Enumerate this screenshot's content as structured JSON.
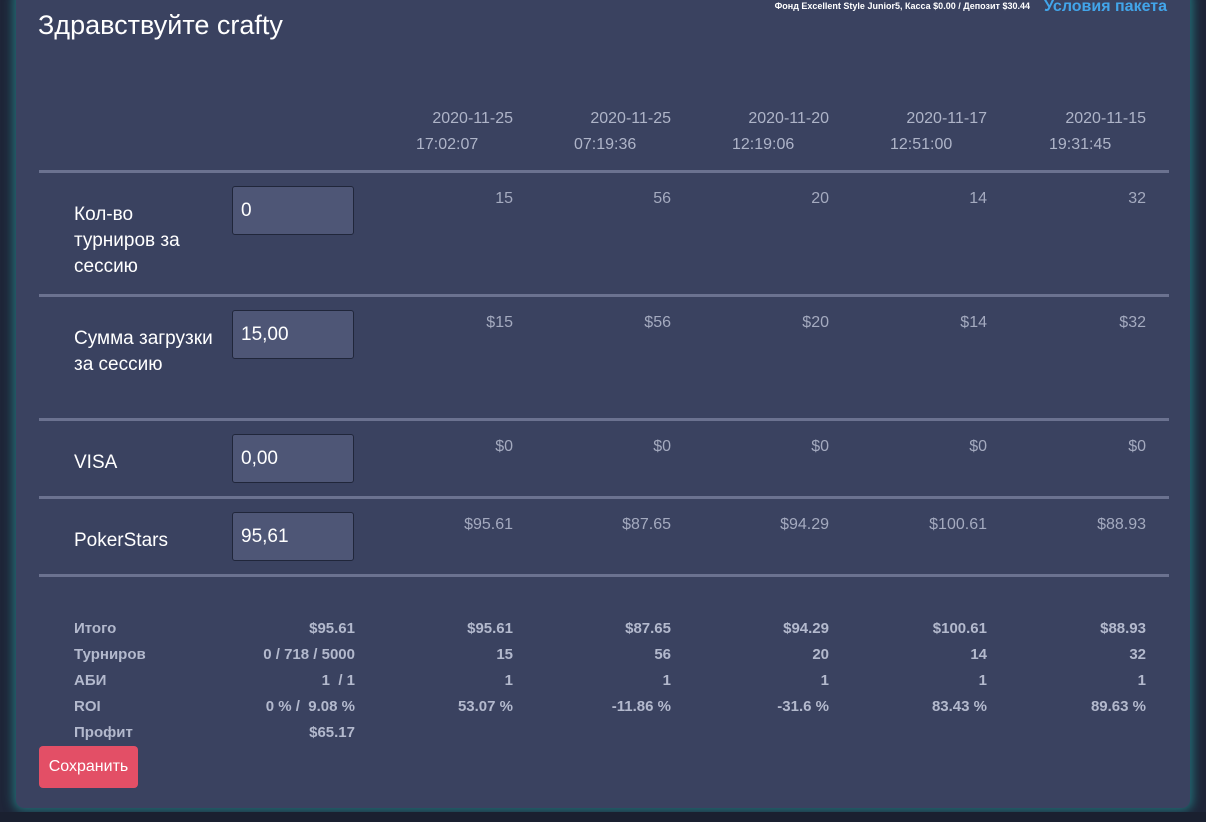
{
  "header": {
    "greeting": "Здравствуйте crafty",
    "fund_info": "Фонд Excellent Style Junior5, Касса $0.00 / Депозит $30.44",
    "package_link": "Условия пакета"
  },
  "sessions": [
    {
      "date": "2020-11-25",
      "time": "17:02:07"
    },
    {
      "date": "2020-11-25",
      "time": "07:19:36"
    },
    {
      "date": "2020-11-20",
      "time": "12:19:06"
    },
    {
      "date": "2020-11-17",
      "time": "12:51:00"
    },
    {
      "date": "2020-11-15",
      "time": "19:31:45"
    }
  ],
  "rows": [
    {
      "label": "Кол-во турниров за сессию",
      "input": "0",
      "values": [
        "15",
        "56",
        "20",
        "14",
        "32"
      ]
    },
    {
      "label": "Сумма загрузки за сессию",
      "input": "15,00",
      "values": [
        "$15",
        "$56",
        "$20",
        "$14",
        "$32"
      ]
    },
    {
      "label": "VISA",
      "input": "0,00",
      "values": [
        "$0",
        "$0",
        "$0",
        "$0",
        "$0"
      ]
    },
    {
      "label": "PokerStars",
      "input": "95,61",
      "values": [
        "$95.61",
        "$87.65",
        "$94.29",
        "$100.61",
        "$88.93"
      ]
    }
  ],
  "summary": [
    {
      "label": "Итого",
      "total": "$95.61",
      "values": [
        "$95.61",
        "$87.65",
        "$94.29",
        "$100.61",
        "$88.93"
      ]
    },
    {
      "label": "Турниров",
      "total": "0 / 718 / 5000",
      "values": [
        "15",
        "56",
        "20",
        "14",
        "32"
      ]
    },
    {
      "label": "АБИ",
      "total": "1  / 1",
      "values": [
        "1",
        "1",
        "1",
        "1",
        "1"
      ]
    },
    {
      "label": "ROI",
      "total": "0 % /  9.08 %",
      "values": [
        "53.07 %",
        "-11.86 %",
        "-31.6 %",
        "83.43 %",
        "89.63 %"
      ]
    },
    {
      "label": "Профит",
      "total": "$65.17",
      "values": [
        "",
        "",
        "",
        "",
        ""
      ]
    }
  ],
  "save_button": "Сохранить"
}
